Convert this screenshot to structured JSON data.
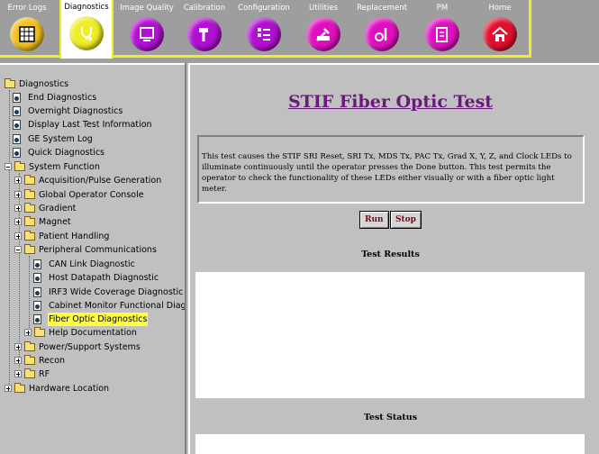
{
  "toolbar": {
    "tabs": [
      {
        "label": "Error Logs",
        "color": "#f0c020",
        "icon": "grid-icon"
      },
      {
        "label": "Diagnostics",
        "color": "#f0ec28",
        "icon": "stethoscope-icon",
        "active": true
      },
      {
        "label": "Image Quality",
        "color": "#b010d0",
        "icon": "monitor-icon"
      },
      {
        "label": "Calibration",
        "color": "#b010d0",
        "icon": "hammer-icon"
      },
      {
        "label": "Configuration",
        "color": "#b010d0",
        "icon": "checklist-icon"
      },
      {
        "label": "Utilities",
        "color": "#e010c0",
        "icon": "tools-icon"
      },
      {
        "label": "Replacement",
        "color": "#e010c0",
        "icon": "wrench-icon"
      },
      {
        "label": "PM",
        "color": "#e010c0",
        "icon": "clipboard-icon"
      },
      {
        "label": "Home",
        "color": "#e01030",
        "icon": "house-icon"
      }
    ]
  },
  "tree": {
    "items": [
      {
        "label": "Diagnostics",
        "type": "folder-open",
        "level": 0
      },
      {
        "label": "End Diagnostics",
        "type": "doc",
        "level": 1
      },
      {
        "label": "Overnight Diagnostics",
        "type": "doc",
        "level": 1
      },
      {
        "label": "Display Last Test Information",
        "type": "doc",
        "level": 1
      },
      {
        "label": "GE System Log",
        "type": "doc",
        "level": 1
      },
      {
        "label": "Quick Diagnostics",
        "type": "doc",
        "level": 1
      },
      {
        "label": "System Function",
        "type": "folder-open",
        "level": 1
      },
      {
        "label": "Acquisition/Pulse Generation",
        "type": "folder",
        "level": 2
      },
      {
        "label": "Global Operator Console",
        "type": "folder",
        "level": 2
      },
      {
        "label": "Gradient",
        "type": "folder",
        "level": 2
      },
      {
        "label": "Magnet",
        "type": "folder",
        "level": 2
      },
      {
        "label": "Patient Handling",
        "type": "folder",
        "level": 2
      },
      {
        "label": "Peripheral Communications",
        "type": "folder-open",
        "level": 2
      },
      {
        "label": "CAN Link Diagnostic",
        "type": "doc",
        "level": 3
      },
      {
        "label": "Host Datapath Diagnostic",
        "type": "doc",
        "level": 3
      },
      {
        "label": "IRF3 Wide Coverage Diagnostic",
        "type": "doc",
        "level": 3
      },
      {
        "label": "Cabinet Monitor Functional Diag",
        "type": "doc",
        "level": 3
      },
      {
        "label": "Fiber Optic Diagnostics",
        "type": "doc",
        "level": 3,
        "selected": true
      },
      {
        "label": "Help Documentation",
        "type": "folder",
        "level": 3
      },
      {
        "label": "Power/Support Systems",
        "type": "folder",
        "level": 2
      },
      {
        "label": "Recon",
        "type": "folder",
        "level": 2
      },
      {
        "label": "RF",
        "type": "folder",
        "level": 2
      },
      {
        "label": "Hardware Location",
        "type": "folder",
        "level": 0
      }
    ]
  },
  "main": {
    "title": "STIF Fiber Optic Test",
    "description": "This test causes the STIF SRI Reset, SRI Tx, MDS Tx, PAC Tx, Grad X, Y, Z, and Clock LEDs to illuminate continuously until the operator presses the Done button. This test permits the operator to check the functionality of these LEDs either visually or with a fiber optic light meter.",
    "run_label": "Run",
    "stop_label": "Stop",
    "results_title": "Test Results",
    "status_title": "Test Status"
  }
}
